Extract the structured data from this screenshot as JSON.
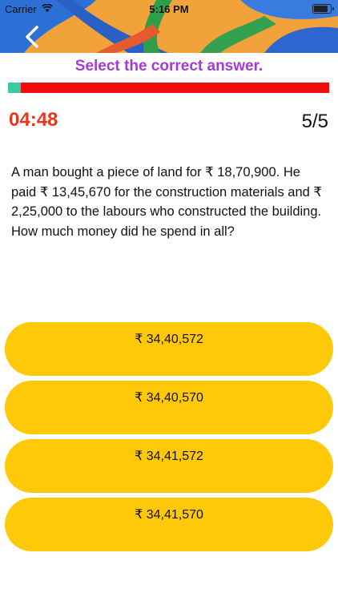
{
  "status_bar": {
    "carrier": "Carrier",
    "time": "5:16 PM"
  },
  "header": {
    "back_icon": "chevron-left-icon"
  },
  "quiz": {
    "instruction": "Select the correct answer.",
    "progress": 0.04,
    "timer": "04:48",
    "counter": "5/5",
    "question": "A man bought a piece of land for ₹ 18,70,900. He paid ₹ 13,45,670 for the construction materials and ₹ 2,25,000 to the labours who constructed the building. How much money did he spend in all?",
    "options": [
      {
        "label": "₹ 34,40,572"
      },
      {
        "label": "₹ 34,40,570"
      },
      {
        "label": "₹ 34,41,572"
      },
      {
        "label": "₹ 34,41,570"
      }
    ]
  },
  "colors": {
    "instruction": "#a43ad8",
    "timer": "#e8371f",
    "progress_fill": "#3ccaa4",
    "progress_track": "#f00d0d",
    "option_bg": "#ffc909"
  }
}
